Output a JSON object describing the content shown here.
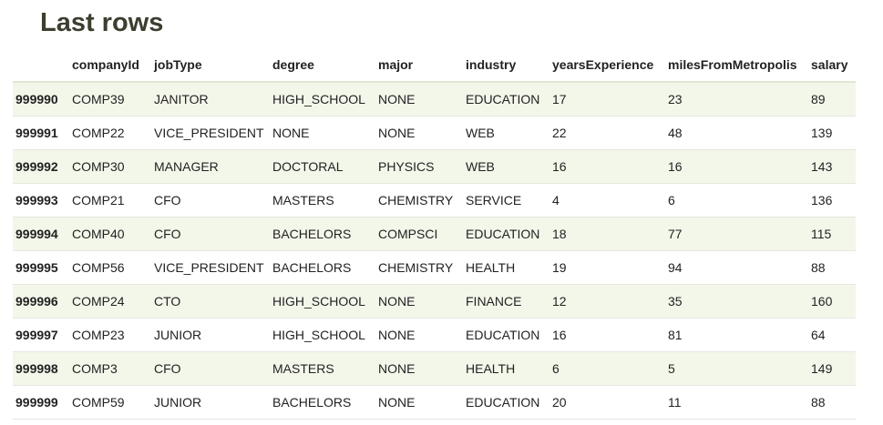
{
  "title": "Last rows",
  "table": {
    "headers": [
      "",
      "companyId",
      "jobType",
      "degree",
      "major",
      "industry",
      "yearsExperience",
      "milesFromMetropolis",
      "salary"
    ],
    "rows": [
      [
        "999990",
        "COMP39",
        "JANITOR",
        "HIGH_SCHOOL",
        "NONE",
        "EDUCATION",
        "17",
        "23",
        "89"
      ],
      [
        "999991",
        "COMP22",
        "VICE_PRESIDENT",
        "NONE",
        "NONE",
        "WEB",
        "22",
        "48",
        "139"
      ],
      [
        "999992",
        "COMP30",
        "MANAGER",
        "DOCTORAL",
        "PHYSICS",
        "WEB",
        "16",
        "16",
        "143"
      ],
      [
        "999993",
        "COMP21",
        "CFO",
        "MASTERS",
        "CHEMISTRY",
        "SERVICE",
        "4",
        "6",
        "136"
      ],
      [
        "999994",
        "COMP40",
        "CFO",
        "BACHELORS",
        "COMPSCI",
        "EDUCATION",
        "18",
        "77",
        "115"
      ],
      [
        "999995",
        "COMP56",
        "VICE_PRESIDENT",
        "BACHELORS",
        "CHEMISTRY",
        "HEALTH",
        "19",
        "94",
        "88"
      ],
      [
        "999996",
        "COMP24",
        "CTO",
        "HIGH_SCHOOL",
        "NONE",
        "FINANCE",
        "12",
        "35",
        "160"
      ],
      [
        "999997",
        "COMP23",
        "JUNIOR",
        "HIGH_SCHOOL",
        "NONE",
        "EDUCATION",
        "16",
        "81",
        "64"
      ],
      [
        "999998",
        "COMP3",
        "CFO",
        "MASTERS",
        "NONE",
        "HEALTH",
        "6",
        "5",
        "149"
      ],
      [
        "999999",
        "COMP59",
        "JUNIOR",
        "BACHELORS",
        "NONE",
        "EDUCATION",
        "20",
        "11",
        "88"
      ]
    ]
  },
  "colors": {
    "stripe": "#f3f7ea",
    "title": "#3d3d30"
  }
}
